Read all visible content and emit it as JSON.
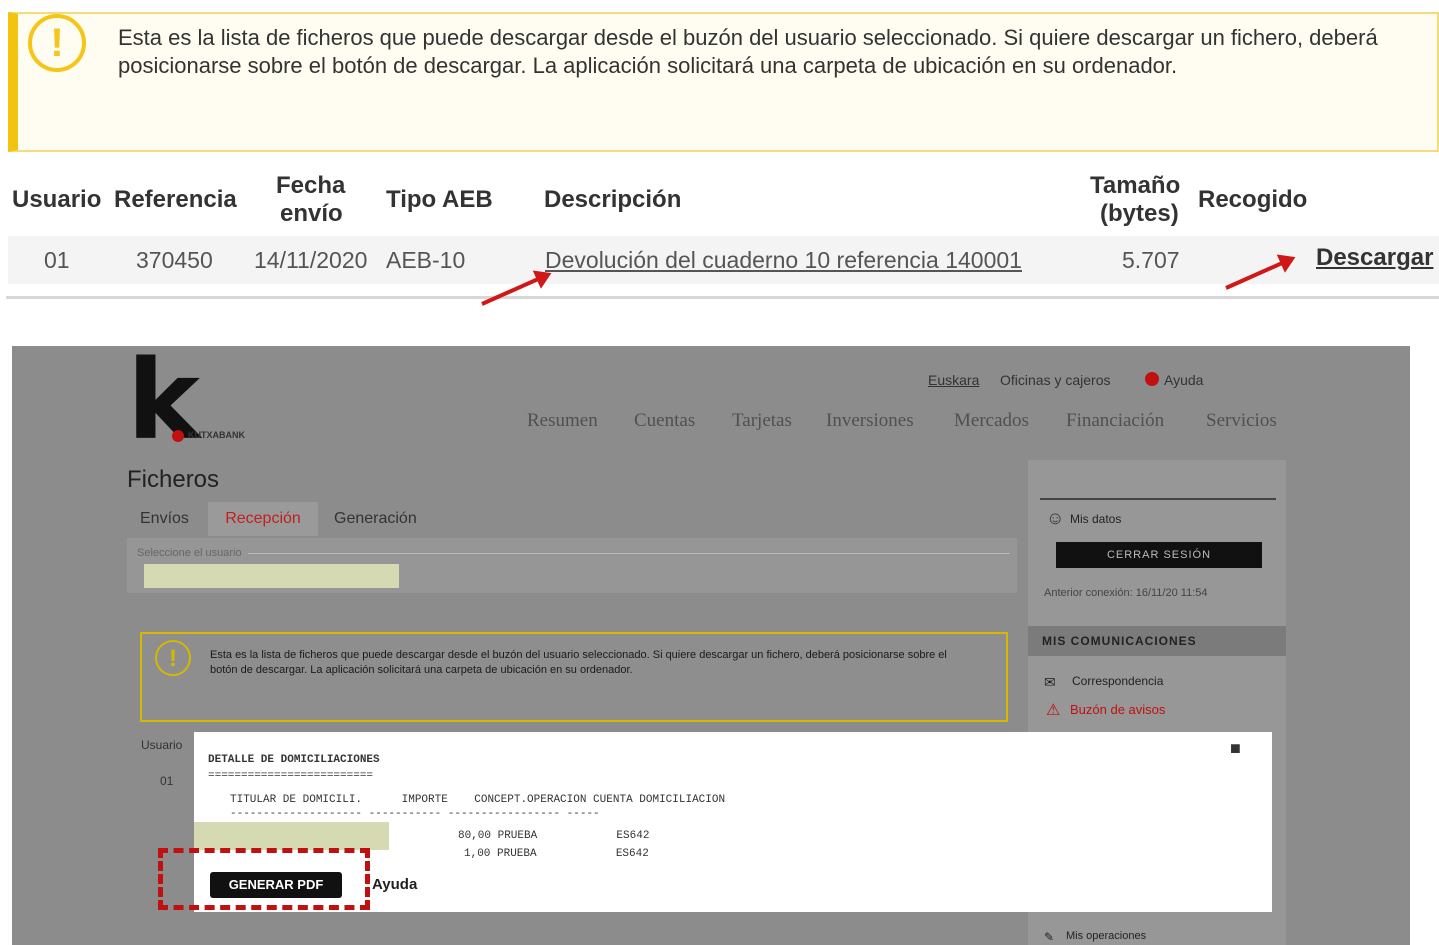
{
  "notice": {
    "text": "Esta es la lista de ficheros que puede descargar desde el buzón del usuario seleccionado. Si quiere descargar un fichero, deberá posicionarse sobre el botón de descargar. La aplicación solicitará una carpeta de ubicación en su ordenador."
  },
  "table": {
    "headers": {
      "usuario": "Usuario",
      "referencia": "Referencia",
      "fecha_1": "Fecha",
      "fecha_2": "envío",
      "tipo": "Tipo AEB",
      "descripcion": "Descripción",
      "tamano_1": "Tamaño",
      "tamano_2": "(bytes)",
      "recogido": "Recogido"
    },
    "row": {
      "usuario": "01",
      "referencia": "370450",
      "fecha": "14/11/2020",
      "tipo": "AEB-10",
      "descripcion": "Devolución del cuaderno 10 referencia 140001",
      "tamano": "5.707",
      "action": "Descargar"
    }
  },
  "app": {
    "logo": {
      "letter": "k",
      "sub": "KUTXABANK"
    },
    "top_links": {
      "euskara": "Euskara",
      "oficinas": "Oficinas y cajeros",
      "ayuda": "Ayuda"
    },
    "nav": [
      "Resumen",
      "Cuentas",
      "Tarjetas",
      "Inversiones",
      "Mercados",
      "Financiación",
      "Servicios"
    ],
    "page_title": "Ficheros",
    "tabs": {
      "envios": "Envíos",
      "recepcion": "Recepción",
      "generacion": "Generación"
    },
    "user_select_label": "Seleccione el usuario",
    "notice_text": "Esta es la lista de ficheros que puede descargar desde el buzón del usuario seleccionado. Si quiere descargar un fichero, deberá posicionarse sobre el botón de descargar. La aplicación solicitará una carpeta de ubicación en su ordenador.",
    "side": {
      "mis_datos": "Mis datos",
      "cerrar_sesion": "CERRAR SESIÓN",
      "anterior_conexion": "Anterior conexión: 16/11/20 11:54",
      "comunicaciones": "MIS COMUNICACIONES",
      "correspondencia": "Correspondencia",
      "buzon_avisos": "Buzón de avisos",
      "mis_operaciones": "Mis operaciones"
    },
    "usuario_label": "Usuario",
    "usuario_value": "01",
    "popup": {
      "title": "DETALLE DE DOMICILIACIONES",
      "underline": "=========================",
      "col_header": "TITULAR DE DOMICILI.      IMPORTE    CONCEPT.OPERACION CUENTA DOMICILIACION",
      "col_rule": "-------------------- ----------- ----------------- -----",
      "line1": "80,00 PRUEBA            ES642",
      "line2": "1,00 PRUEBA            ES642",
      "generate_pdf": "GENERAR PDF",
      "ayuda": "Ayuda"
    }
  },
  "colors": {
    "accent_yellow": "#f1c40f",
    "arrow_red": "#d01818",
    "brand_red": "#c01010"
  }
}
